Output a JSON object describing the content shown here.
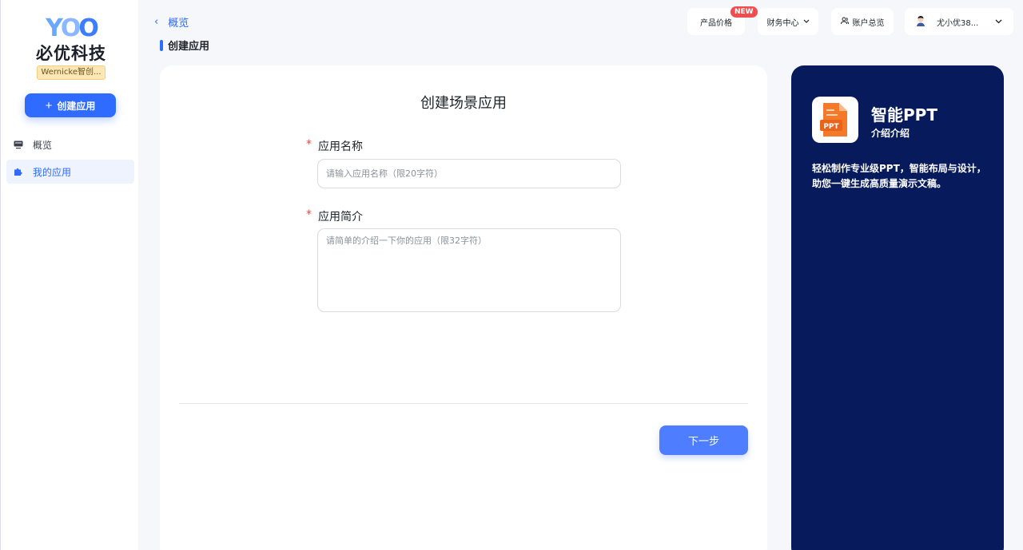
{
  "brand": {
    "logo_text": "YOO",
    "name": "必优科技",
    "org_badge": "Wernicke智创..."
  },
  "sidebar": {
    "create_button": "创建应用",
    "items": [
      {
        "label": "概览",
        "icon": "monitor-icon",
        "active": false
      },
      {
        "label": "我的应用",
        "icon": "puzzle-icon",
        "active": true
      }
    ]
  },
  "header": {
    "back_label": "概览",
    "page_title": "创建应用",
    "pills": {
      "price": "产品价格",
      "price_badge": "NEW",
      "finance": "财务中心",
      "account": "账户总览",
      "user": "尤小优38..."
    }
  },
  "form": {
    "title": "创建场景应用",
    "name_label": "应用名称",
    "name_placeholder": "请输入应用名称（限20字符）",
    "desc_label": "应用简介",
    "desc_placeholder": "请简单的介绍一下你的应用（限32字符）",
    "required_mark": "*",
    "next_button": "下一步"
  },
  "promo": {
    "icon_text": "PPT",
    "name": "智能PPT",
    "subtitle": "介绍介绍",
    "description": "轻松制作专业级PPT，智能布局与设计，助您一键生成高质量演示文稿。"
  },
  "colors": {
    "accent": "#2f6bff",
    "promo_bg": "#061a5c",
    "badge_red": "#f04e4e"
  }
}
